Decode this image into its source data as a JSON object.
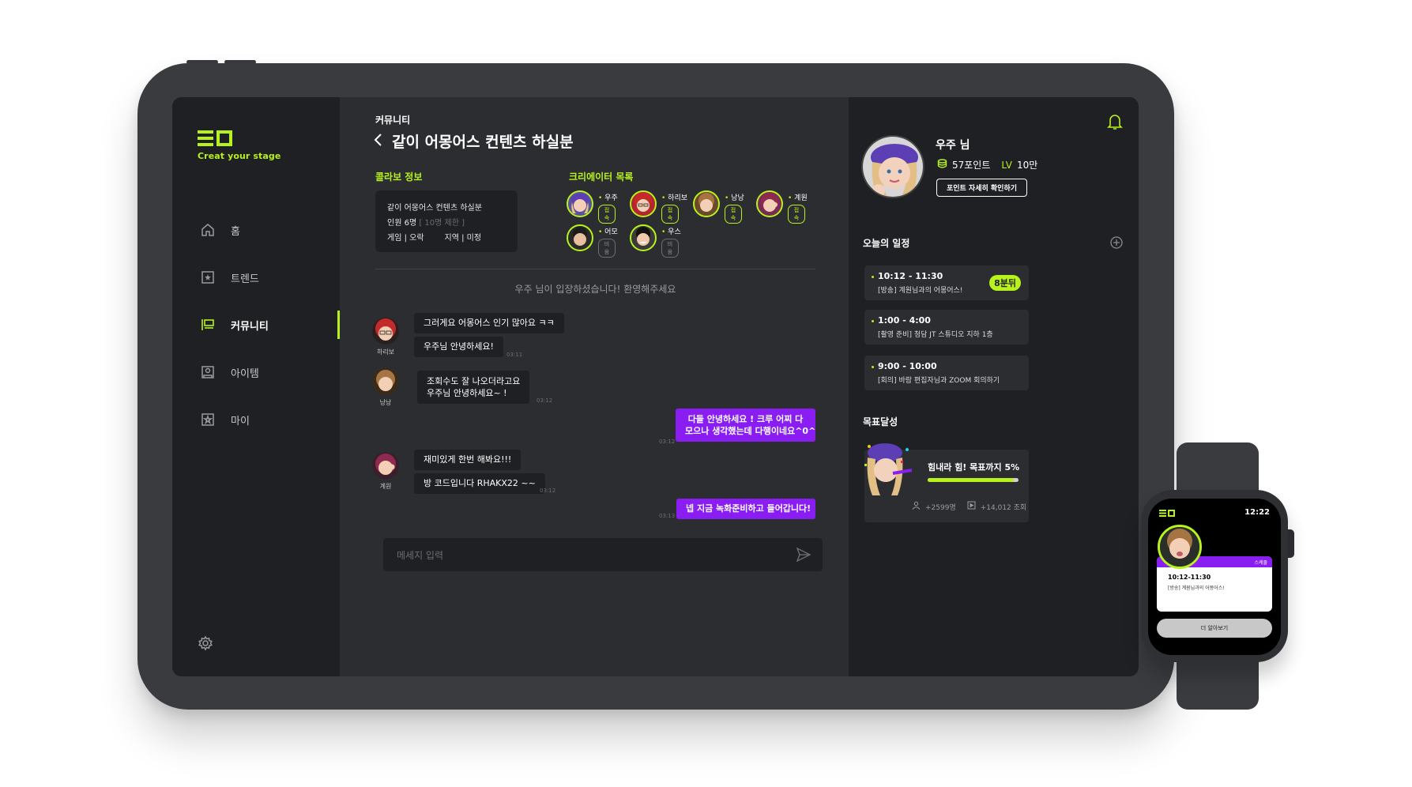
{
  "brand": {
    "tagline": "Creat your stage",
    "accent": "#b7f21d",
    "purple": "#8a1df2"
  },
  "nav": [
    {
      "label": "홈",
      "icon": "home-icon"
    },
    {
      "label": "트렌드",
      "icon": "trend-icon"
    },
    {
      "label": "커뮤니티",
      "icon": "community-icon",
      "active": true
    },
    {
      "label": "아이템",
      "icon": "item-icon"
    },
    {
      "label": "마이",
      "icon": "my-icon"
    }
  ],
  "main": {
    "breadcrumb": "커뮤니티",
    "title": "같이 어몽어스 컨텐츠 하실분",
    "collab_label": "콜라보 정보",
    "collab": {
      "name": "같이 어몽어스 컨텐츠 하실분",
      "members_label": "인원 6명",
      "members_limit": "[ 10명 제한 ]",
      "category": "게임 | 오락",
      "region": "지역 | 미정"
    },
    "creators_label": "크리에이터 목록",
    "creators": [
      {
        "name": "우주",
        "status": "접속"
      },
      {
        "name": "하리보",
        "status": "접속"
      },
      {
        "name": "낭낭",
        "status": "접속"
      },
      {
        "name": "계원",
        "status": "접속"
      },
      {
        "name": "어모",
        "status": "비움"
      },
      {
        "name": "우스",
        "status": "비움"
      }
    ],
    "system_message": "우주 님이 입장하셨습니다! 환영해주세요",
    "messages": [
      {
        "sender": "하리보",
        "text": "그러게요 어몽어스 인기 많아요 ㅋㅋ"
      },
      {
        "sender": "하리보",
        "text": "우주님 안녕하세요!",
        "time": "03:11"
      },
      {
        "sender": "낭낭",
        "text": "조회수도 잘 나오더라고요",
        "text2": "우주님 안녕하세요~ !",
        "time": "03:12"
      },
      {
        "sender": "me",
        "text": "다들 안녕하세요 ! 크루 어찌 다",
        "text2": "모으나 생각했는데 다행이네요^0^",
        "time": "03:12"
      },
      {
        "sender": "계원",
        "text": "재미있게 한번 해봐요!!!"
      },
      {
        "sender": "계원",
        "text": "방 코드입니다 RHAKX22 ~~",
        "time": "03:12"
      },
      {
        "sender": "me",
        "text": "넵 지금 녹화준비하고 들어갑니다!",
        "time": "03:13"
      }
    ],
    "input_placeholder": "메세지 입력"
  },
  "profile": {
    "name": "우주 님",
    "points": "57포인트",
    "level_label": "LV",
    "level_value": "10만",
    "points_button": "포인트 자세히 확인하기"
  },
  "schedule": {
    "label": "오늘의 일정",
    "items": [
      {
        "time": "10:12 - 11:30",
        "desc": "[방송] 계원님과의 어몽어스!",
        "tag": "8분뒤"
      },
      {
        "time": "1:00 - 4:00",
        "desc": "[촬영 준비] 청담 JT 스튜디오 지하 1층"
      },
      {
        "time": "9:00 - 10:00",
        "desc": "[회의] 바람 편집자님과 ZOOM 회의하기"
      }
    ]
  },
  "goal": {
    "label": "목표달성",
    "title": "힘내라 힘! 목표까지 5%",
    "progress": 0.95,
    "subscribers": "+2599명",
    "views": "+14,012 조회"
  },
  "watch": {
    "time": "12:22",
    "card_header": "스케줄",
    "card_time": "10:12-11:30",
    "card_desc": "[방송] 계원님과의 어몽어스!",
    "more_button": "더 알아보기"
  }
}
